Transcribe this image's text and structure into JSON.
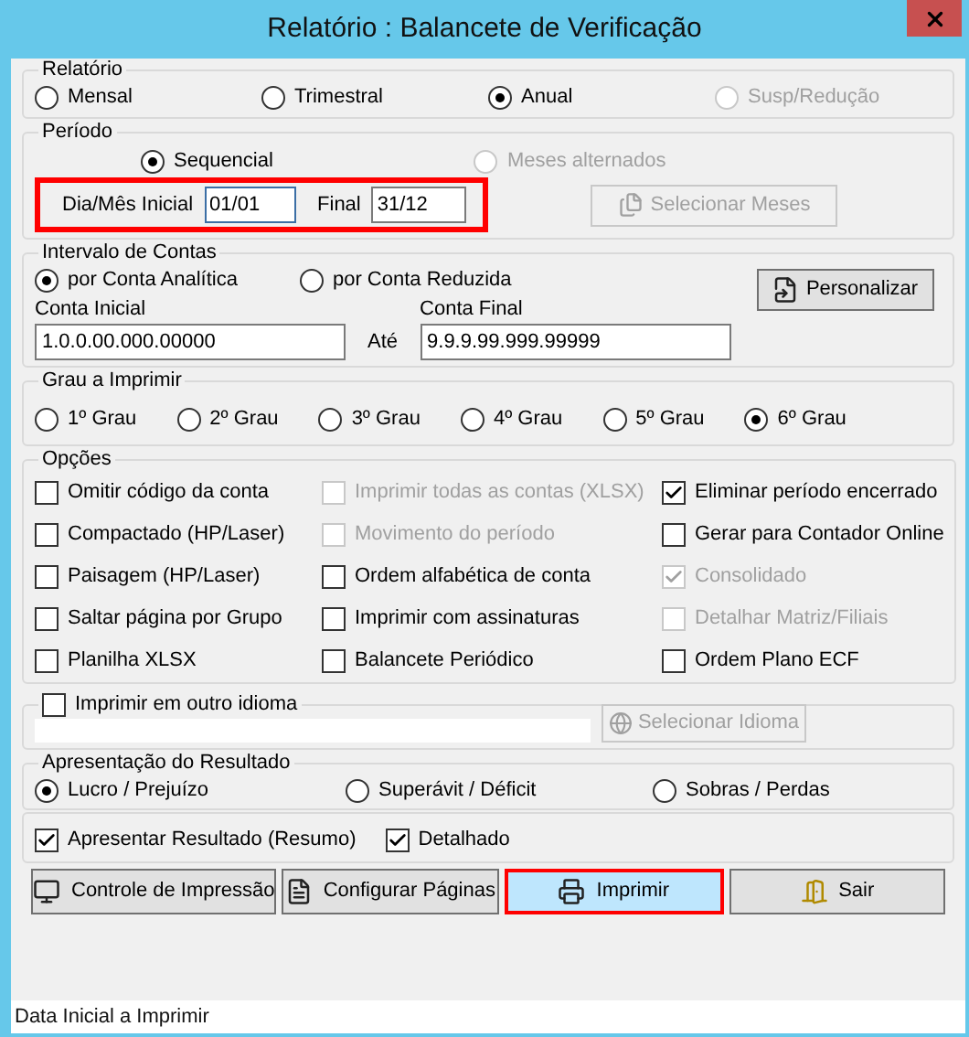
{
  "window": {
    "title": "Relatório : Balancete de Verificação"
  },
  "report_type": {
    "label": "Relatório",
    "options": [
      {
        "label": "Mensal",
        "selected": false,
        "disabled": false
      },
      {
        "label": "Trimestral",
        "selected": false,
        "disabled": false
      },
      {
        "label": "Anual",
        "selected": true,
        "disabled": false
      },
      {
        "label": "Susp/Redução",
        "selected": false,
        "disabled": true
      }
    ]
  },
  "period": {
    "label": "Período",
    "options": [
      {
        "label": "Sequencial",
        "selected": true,
        "disabled": false
      },
      {
        "label": "Meses alternados",
        "selected": false,
        "disabled": true
      }
    ],
    "start_label": "Dia/Mês Inicial",
    "start_value": "01/01",
    "end_label": "Final",
    "end_value": "31/12",
    "highlighted": true,
    "select_months_button": {
      "label": "Selecionar Meses",
      "disabled": true
    }
  },
  "account_range": {
    "label": "Intervalo de Contas",
    "options": [
      {
        "label": "por Conta Analítica",
        "selected": true,
        "disabled": false
      },
      {
        "label": "por Conta Reduzida",
        "selected": false,
        "disabled": false
      }
    ],
    "customize_button": "Personalizar",
    "start_label": "Conta Inicial",
    "start_value": "1.0.0.00.000.00000",
    "between": "Até",
    "end_label": "Conta Final",
    "end_value": "9.9.9.99.999.99999"
  },
  "level": {
    "label": "Grau a Imprimir",
    "options": [
      {
        "label": "1º Grau",
        "selected": false,
        "disabled": false
      },
      {
        "label": "2º Grau",
        "selected": false,
        "disabled": false
      },
      {
        "label": "3º Grau",
        "selected": false,
        "disabled": false
      },
      {
        "label": "4º Grau",
        "selected": false,
        "disabled": false
      },
      {
        "label": "5º Grau",
        "selected": false,
        "disabled": false
      },
      {
        "label": "6º Grau",
        "selected": true,
        "disabled": false
      }
    ]
  },
  "options": {
    "label": "Opções",
    "items": [
      {
        "label": "Omitir código da conta",
        "checked": false,
        "disabled": false
      },
      {
        "label": "Imprimir todas as contas (XLSX)",
        "checked": false,
        "disabled": true
      },
      {
        "label": "Eliminar período encerrado",
        "checked": true,
        "disabled": false
      },
      {
        "label": "Compactado (HP/Laser)",
        "checked": false,
        "disabled": false
      },
      {
        "label": "Movimento do período",
        "checked": false,
        "disabled": true
      },
      {
        "label": "Gerar para Contador Online",
        "checked": false,
        "disabled": false
      },
      {
        "label": "Paisagem (HP/Laser)",
        "checked": false,
        "disabled": false
      },
      {
        "label": "Ordem alfabética de conta",
        "checked": false,
        "disabled": false
      },
      {
        "label": "Consolidado",
        "checked": true,
        "disabled": true
      },
      {
        "label": "Saltar página por Grupo",
        "checked": false,
        "disabled": false
      },
      {
        "label": "Imprimir com assinaturas",
        "checked": false,
        "disabled": false
      },
      {
        "label": "Detalhar Matriz/Filiais",
        "checked": false,
        "disabled": true
      },
      {
        "label": "Planilha XLSX",
        "checked": false,
        "disabled": false
      },
      {
        "label": "Balancete Periódico",
        "checked": false,
        "disabled": false
      },
      {
        "label": "Ordem Plano ECF",
        "checked": false,
        "disabled": false
      }
    ]
  },
  "language": {
    "checkbox": {
      "label": "Imprimir em outro idioma",
      "checked": false,
      "disabled": false
    },
    "button": {
      "label": "Selecionar Idioma",
      "disabled": true
    }
  },
  "result": {
    "label": "Apresentação do Resultado",
    "options": [
      {
        "label": "Lucro / Prejuízo",
        "selected": true,
        "disabled": false
      },
      {
        "label": "Superávit / Déficit",
        "selected": false,
        "disabled": false
      },
      {
        "label": "Sobras / Perdas",
        "selected": false,
        "disabled": false
      }
    ]
  },
  "summary": [
    {
      "label": "Apresentar Resultado (Resumo)",
      "checked": true,
      "disabled": false
    },
    {
      "label": "Detalhado",
      "checked": true,
      "disabled": false
    }
  ],
  "buttons": [
    {
      "label": "Controle de Impressão",
      "kind": "monitor",
      "highlighted": false
    },
    {
      "label": "Configurar Páginas",
      "kind": "page",
      "highlighted": false
    },
    {
      "label": "Imprimir",
      "kind": "printer",
      "highlighted": true
    },
    {
      "label": "Sair",
      "kind": "door",
      "highlighted": false
    }
  ],
  "status_bar": "Data Inicial a Imprimir"
}
